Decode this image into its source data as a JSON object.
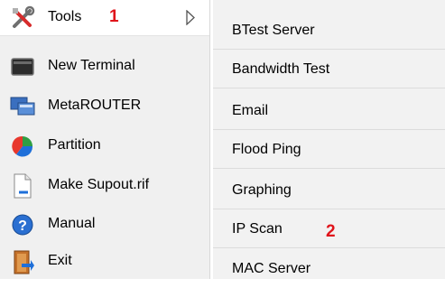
{
  "left_menu": {
    "items": [
      {
        "label": "Tools",
        "icon": "tools-icon",
        "marker": "1",
        "has_submenu": true
      },
      {
        "label": "New Terminal",
        "icon": "terminal-icon"
      },
      {
        "label": "MetaROUTER",
        "icon": "metarouter-icon"
      },
      {
        "label": "Partition",
        "icon": "partition-icon"
      },
      {
        "label": "Make Supout.rif",
        "icon": "document-icon"
      },
      {
        "label": "Manual",
        "icon": "help-icon"
      },
      {
        "label": "Exit",
        "icon": "exit-icon"
      }
    ]
  },
  "submenu": {
    "items": [
      {
        "label": "BTest Server"
      },
      {
        "label": "Bandwidth Test"
      },
      {
        "label": "Email"
      },
      {
        "label": "Flood Ping"
      },
      {
        "label": "Graphing"
      },
      {
        "label": "IP Scan",
        "marker": "2"
      },
      {
        "label": "MAC Server"
      }
    ]
  },
  "colors": {
    "marker": "#e0141b",
    "accent_blue": "#1e6fd9"
  }
}
